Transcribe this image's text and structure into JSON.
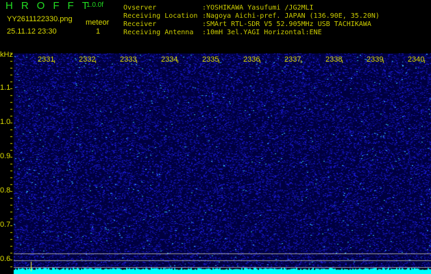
{
  "header": {
    "logo": "HROFFT",
    "version": "1.0.0f",
    "filename": "YY2611122330.png",
    "timestamp": "25.11.12 23:30",
    "mode": "meteor",
    "count": "1"
  },
  "info": [
    {
      "label": "Ovserver",
      "value": ":YOSHIKAWA Yasufumi /JG2MLI"
    },
    {
      "label": "Receiving Location",
      "value": ":Nagoya Aichi-pref. JAPAN (136.90E, 35.20N)"
    },
    {
      "label": "Receiver",
      "value": ":SMArt RTL-SDR V5 52.905MHz USB TACHIKAWA"
    },
    {
      "label": "Receiving Antenna",
      "value": ":10mH 3el.YAGI Horizontal:ENE"
    }
  ],
  "axis": {
    "unit": "kHz",
    "y_ticks": [
      "1.1",
      "1.0",
      "0.9",
      "0.8",
      "0.7",
      "0.6"
    ],
    "x_ticks": [
      "2331",
      "2332",
      "2333",
      "2334",
      "2335",
      "2336",
      "2337",
      "2338",
      "2339",
      "2340"
    ]
  },
  "colors": {
    "text": "#dddd00",
    "logo": "#22dd22",
    "noise": "#1010c0",
    "floor": "#00ffff"
  }
}
